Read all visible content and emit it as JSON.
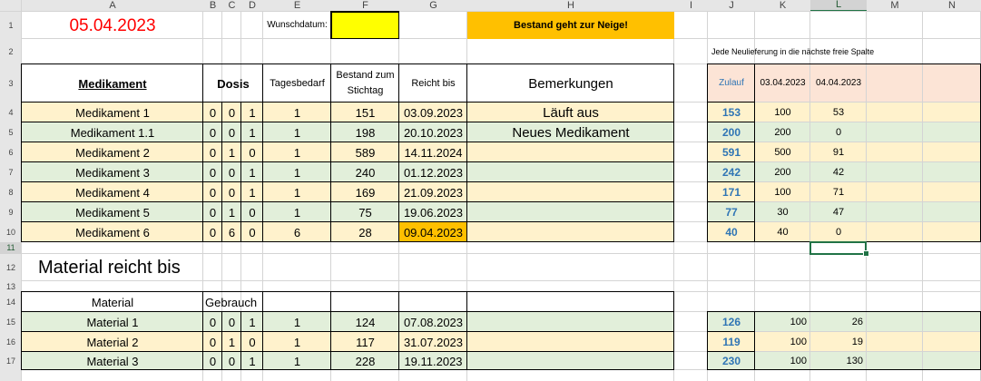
{
  "colors": {
    "beige": "#fff2cc",
    "green": "#e2efda",
    "salmon": "#fce4d6",
    "yellow": "#ffff00",
    "orange": "#ffc000",
    "red_text": "#ff0000",
    "blue_text": "#2f75b5",
    "selection": "#217346"
  },
  "columns": [
    "A",
    "B",
    "C",
    "D",
    "E",
    "F",
    "G",
    "H",
    "I",
    "J",
    "K",
    "L",
    "M",
    "N"
  ],
  "rows": [
    "1",
    "2",
    "3",
    "4",
    "5",
    "6",
    "7",
    "8",
    "9",
    "10",
    "11",
    "12",
    "13",
    "14",
    "15",
    "16",
    "17",
    ""
  ],
  "selected_cell": "L11",
  "header": {
    "date": "05.04.2023",
    "wunsch_label": "Wunschdatum:",
    "warning": "Bestand geht zur Neige!",
    "note": "Jede Neulieferung in die nächste freie Spalte"
  },
  "med_table": {
    "col_medikament": "Medikament",
    "col_dosis": "Dosis",
    "col_tagesbedarf": "Tagesbedarf",
    "col_bestand_line1": "Bestand zum",
    "col_bestand_line2": "Stichtag",
    "col_reicht": "Reicht bis",
    "col_bemerkungen": "Bemerkungen",
    "rows": [
      {
        "name": "Medikament 1",
        "d1": "0",
        "d2": "0",
        "d3": "1",
        "bedarf": "1",
        "bestand": "151",
        "reicht": "03.09.2023",
        "bem": "Läuft aus",
        "alert": false
      },
      {
        "name": "Medikament 1.1",
        "d1": "0",
        "d2": "0",
        "d3": "1",
        "bedarf": "1",
        "bestand": "198",
        "reicht": "20.10.2023",
        "bem": "Neues Medikament",
        "alert": false
      },
      {
        "name": "Medikament 2",
        "d1": "0",
        "d2": "1",
        "d3": "0",
        "bedarf": "1",
        "bestand": "589",
        "reicht": "14.11.2024",
        "bem": "",
        "alert": false
      },
      {
        "name": "Medikament 3",
        "d1": "0",
        "d2": "0",
        "d3": "1",
        "bedarf": "1",
        "bestand": "240",
        "reicht": "01.12.2023",
        "bem": "",
        "alert": false
      },
      {
        "name": "Medikament 4",
        "d1": "0",
        "d2": "0",
        "d3": "1",
        "bedarf": "1",
        "bestand": "169",
        "reicht": "21.09.2023",
        "bem": "",
        "alert": false
      },
      {
        "name": "Medikament 5",
        "d1": "0",
        "d2": "1",
        "d3": "0",
        "bedarf": "1",
        "bestand": "75",
        "reicht": "19.06.2023",
        "bem": "",
        "alert": false
      },
      {
        "name": "Medikament 6",
        "d1": "0",
        "d2": "6",
        "d3": "0",
        "bedarf": "6",
        "bestand": "28",
        "reicht": "09.04.2023",
        "bem": "",
        "alert": true
      }
    ]
  },
  "zulauf": {
    "label": "Zulauf",
    "dates": [
      "03.04.2023",
      "04.04.2023"
    ],
    "rows": [
      {
        "total": "153",
        "v1": "100",
        "v2": "53"
      },
      {
        "total": "200",
        "v1": "200",
        "v2": "0"
      },
      {
        "total": "591",
        "v1": "500",
        "v2": "91"
      },
      {
        "total": "242",
        "v1": "200",
        "v2": "42"
      },
      {
        "total": "171",
        "v1": "100",
        "v2": "71"
      },
      {
        "total": "77",
        "v1": "30",
        "v2": "47"
      },
      {
        "total": "40",
        "v1": "40",
        "v2": "0"
      }
    ]
  },
  "material": {
    "title": "Material reicht bis",
    "col_material": "Material",
    "col_gebrauch": "Gebrauch",
    "rows": [
      {
        "name": "Material 1",
        "d1": "0",
        "d2": "0",
        "d3": "1",
        "bedarf": "1",
        "bestand": "124",
        "reicht": "07.08.2023",
        "total": "126",
        "v1": "100",
        "v2": "26"
      },
      {
        "name": "Material 2",
        "d1": "0",
        "d2": "1",
        "d3": "0",
        "bedarf": "1",
        "bestand": "117",
        "reicht": "31.07.2023",
        "total": "119",
        "v1": "100",
        "v2": "19"
      },
      {
        "name": "Material 3",
        "d1": "0",
        "d2": "0",
        "d3": "1",
        "bedarf": "1",
        "bestand": "228",
        "reicht": "19.11.2023",
        "total": "230",
        "v1": "100",
        "v2": "130"
      }
    ]
  }
}
